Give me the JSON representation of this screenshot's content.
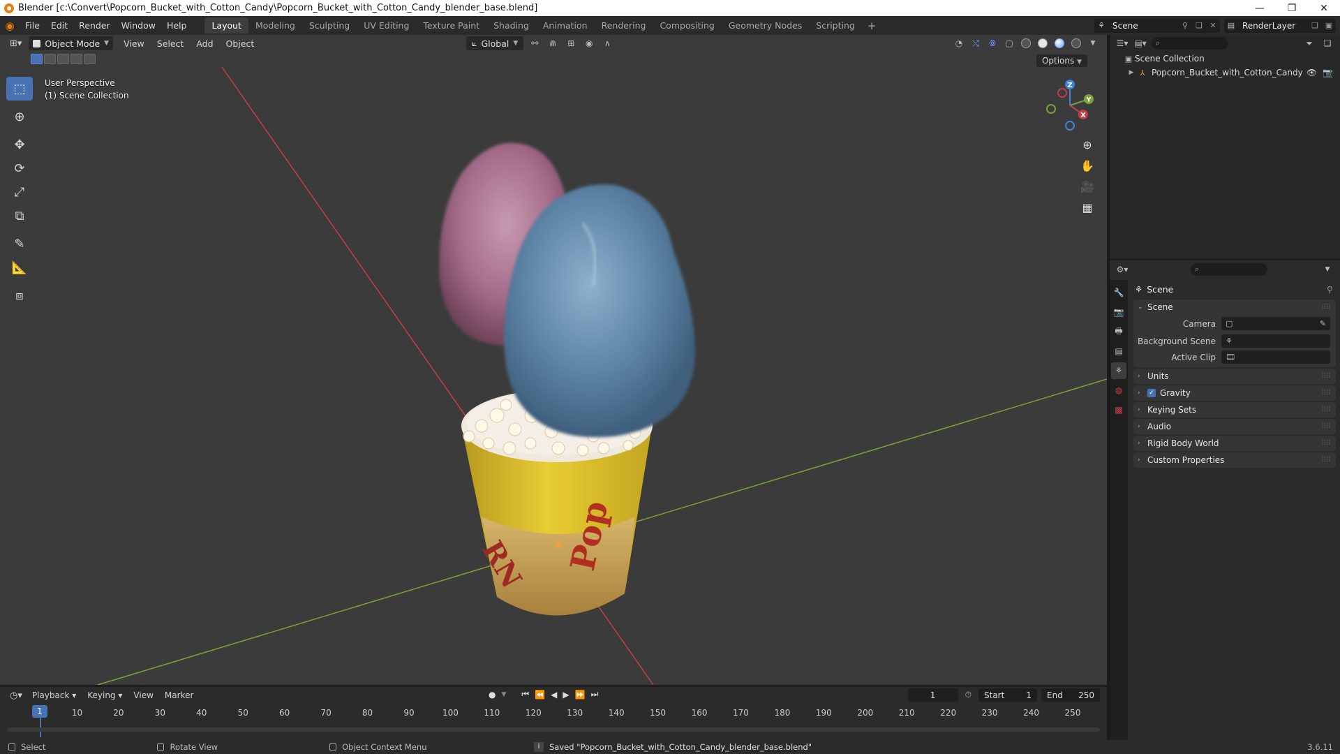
{
  "window": {
    "title": "Blender [c:\\Convert\\Popcorn_Bucket_with_Cotton_Candy\\Popcorn_Bucket_with_Cotton_Candy_blender_base.blend]",
    "minimize": "—",
    "maximize": "❐",
    "close": "✕"
  },
  "menu": {
    "file": "File",
    "edit": "Edit",
    "render": "Render",
    "window": "Window",
    "help": "Help"
  },
  "workspaces": [
    "Layout",
    "Modeling",
    "Sculpting",
    "UV Editing",
    "Texture Paint",
    "Shading",
    "Animation",
    "Rendering",
    "Compositing",
    "Geometry Nodes",
    "Scripting"
  ],
  "workspace_add": "+",
  "top_right": {
    "scene": "Scene",
    "view_layer": "RenderLayer"
  },
  "viewport": {
    "mode": "Object Mode",
    "view": "View",
    "select": "Select",
    "add": "Add",
    "object": "Object",
    "orientation": "Global",
    "options": "Options",
    "info_line1": "User Perspective",
    "info_line2": "(1) Scene Collection",
    "gizmo": {
      "x": "X",
      "y": "Y",
      "z": "Z"
    }
  },
  "outliner": {
    "root": "Scene Collection",
    "object": "Popcorn_Bucket_with_Cotton_Candy"
  },
  "properties": {
    "context": "Scene",
    "panel_scene": "Scene",
    "camera_label": "Camera",
    "background_scene_label": "Background Scene",
    "active_clip_label": "Active Clip",
    "panels": [
      "Units",
      "Gravity",
      "Keying Sets",
      "Audio",
      "Rigid Body World",
      "Custom Properties"
    ],
    "gravity_enabled": true
  },
  "timeline": {
    "playback": "Playback",
    "keying": "Keying",
    "view": "View",
    "marker": "Marker",
    "current_frame": "1",
    "start_label": "Start",
    "start": "1",
    "end_label": "End",
    "end": "250",
    "ruler": [
      "1",
      "10",
      "20",
      "30",
      "40",
      "50",
      "60",
      "70",
      "80",
      "90",
      "100",
      "110",
      "120",
      "130",
      "140",
      "150",
      "160",
      "170",
      "180",
      "190",
      "200",
      "210",
      "220",
      "230",
      "240",
      "250"
    ],
    "playhead": "1"
  },
  "status": {
    "select": "Select",
    "rotate": "Rotate View",
    "context_menu": "Object Context Menu",
    "message": "Saved \"Popcorn_Bucket_with_Cotton_Candy_blender_base.blend\"",
    "version": "3.6.11"
  },
  "colors": {
    "accent": "#4772b3",
    "x_axis": "#c43c48",
    "y_axis": "#7ba339",
    "z_axis": "#3f86d8",
    "bucket_yellow": "#e2c52a",
    "candy_blue": "#5f86a8",
    "candy_pink": "#a56c8a"
  }
}
